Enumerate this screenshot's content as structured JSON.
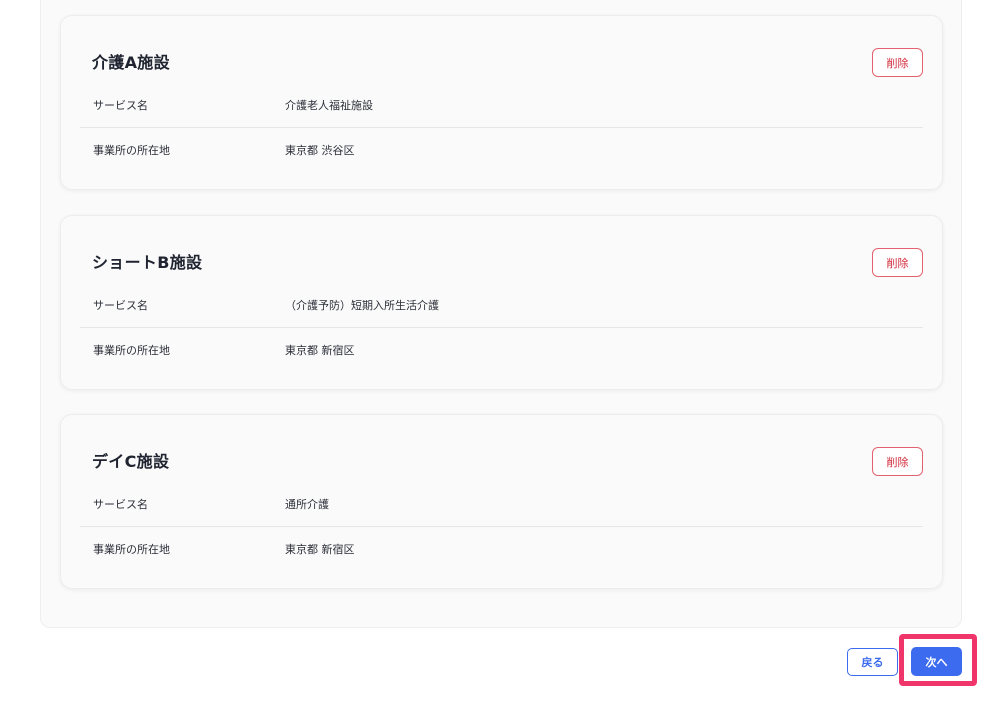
{
  "facilities": [
    {
      "title": "介護A施設",
      "delete_label": "削除",
      "service_label": "サービス名",
      "service_value": "介護老人福祉施設",
      "location_label": "事業所の所在地",
      "location_value": "東京都 渋谷区"
    },
    {
      "title": "ショートB施設",
      "delete_label": "削除",
      "service_label": "サービス名",
      "service_value": "（介護予防）短期入所生活介護",
      "location_label": "事業所の所在地",
      "location_value": "東京都 新宿区"
    },
    {
      "title": "デイC施設",
      "delete_label": "削除",
      "service_label": "サービス名",
      "service_value": "通所介護",
      "location_label": "事業所の所在地",
      "location_value": "東京都 新宿区"
    }
  ],
  "footer": {
    "back_label": "戻る",
    "next_label": "次へ"
  },
  "colors": {
    "primary": "#3d6bf0",
    "danger": "#d12a3a",
    "highlight": "#f0356b"
  }
}
